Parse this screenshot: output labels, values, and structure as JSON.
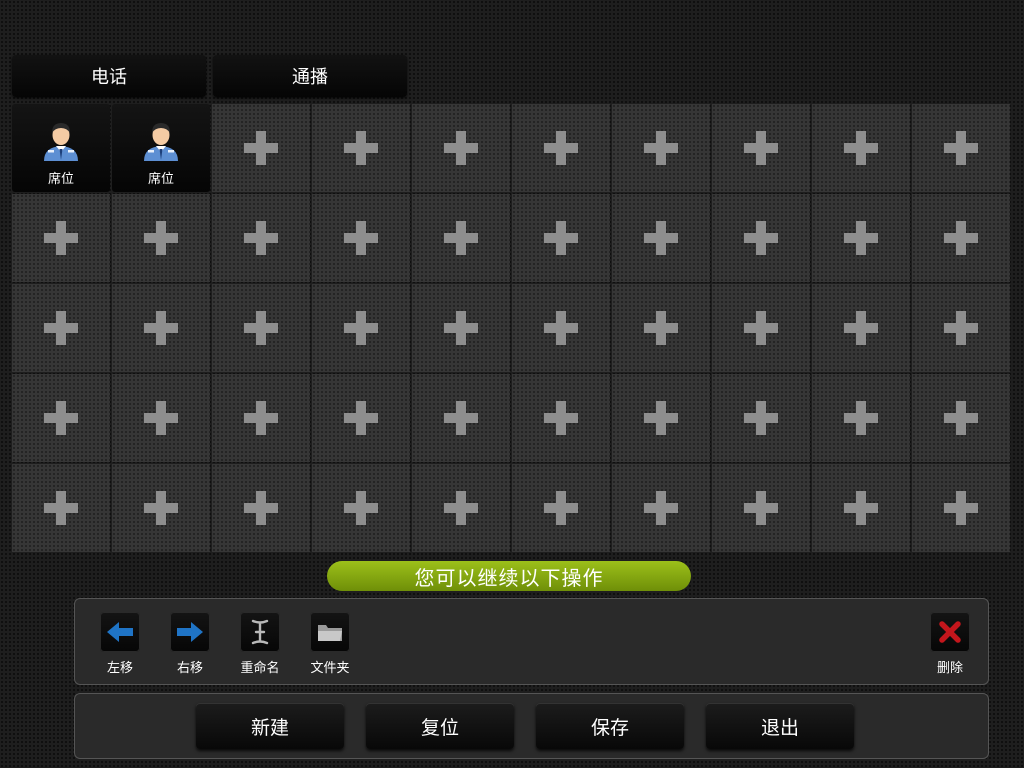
{
  "tabs": [
    {
      "label": "电话"
    },
    {
      "label": "通播"
    }
  ],
  "grid": {
    "columns": 10,
    "rows": 5,
    "seats": [
      {
        "label": "席位",
        "icon": "user-officer-icon"
      },
      {
        "label": "席位",
        "icon": "user-officer-icon"
      }
    ],
    "empty_icon": "plus-icon"
  },
  "hint": "您可以继续以下操作",
  "toolbar": {
    "move_left_label": "左移",
    "move_right_label": "右移",
    "rename_label": "重命名",
    "folder_label": "文件夹",
    "delete_label": "删除"
  },
  "buttons": {
    "new_label": "新建",
    "reset_label": "复位",
    "save_label": "保存",
    "exit_label": "退出"
  },
  "colors": {
    "hint_green": "#8bb10f",
    "arrow_blue": "#1f74c6",
    "delete_red": "#c4161c",
    "plus_gray": "#8e8e8e"
  }
}
